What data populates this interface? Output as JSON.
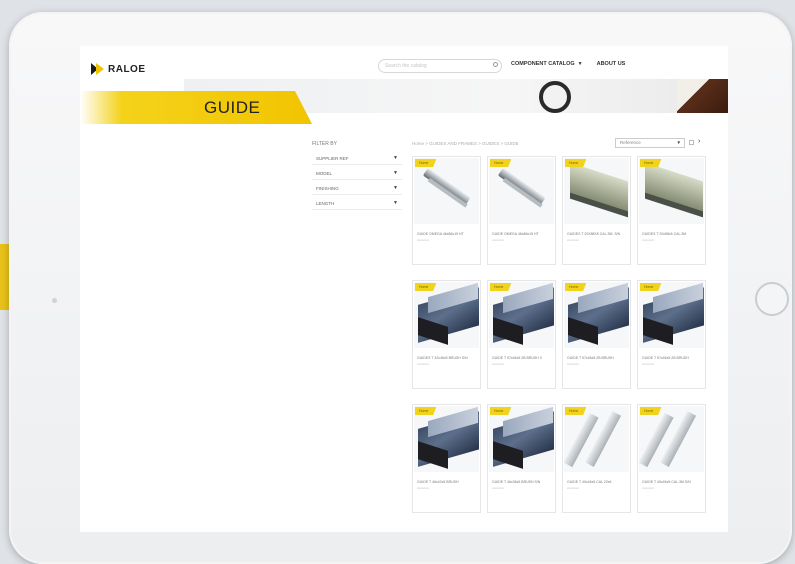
{
  "brand": {
    "name": "RALOE"
  },
  "header": {
    "search_placeholder": "Search the catalog",
    "nav": [
      {
        "label": "COMPONENT CATALOG"
      },
      {
        "label": "ABOUT US"
      }
    ]
  },
  "banner": {
    "title": "GUIDE"
  },
  "filters": {
    "title": "FILTER BY",
    "items": [
      {
        "label": "SUPPLIER REF"
      },
      {
        "label": "MODEL"
      },
      {
        "label": "FINISHING"
      },
      {
        "label": "LENGTH"
      }
    ]
  },
  "breadcrumb": "Home > GUIDES AND FRAMES > GUIDES > GUIDE",
  "sort": {
    "selected": "Reference"
  },
  "products": [
    {
      "name": "GUIDE OMEGA 46x86x15 HT",
      "badge": "Home",
      "sub": "xxxxxxxx",
      "shape": "rail"
    },
    {
      "name": "GUIDE OMEGA 46x86x15 HT",
      "badge": "Home",
      "sub": "xxxxxxxx",
      "shape": "rail"
    },
    {
      "name": "GUIDES T 20X88X5 CAL.3M. S/N",
      "badge": "Home",
      "sub": "xxxxxxxx",
      "shape": "plate"
    },
    {
      "name": "GUIDES T 20x88x5 CAL.3M",
      "badge": "Home",
      "sub": "xxxxxxxx",
      "shape": "plate"
    },
    {
      "name": "GUIDES T 32x46x5 BRUSH S/N",
      "badge": "Home",
      "sub": "xxxxxxxx",
      "shape": "box"
    },
    {
      "name": "GUIDE T 57x46x5 2B BRUSH 3",
      "badge": "Home",
      "sub": "xxxxxxxx",
      "shape": "box"
    },
    {
      "name": "GUIDE T 57x46x5 2B BRUSH",
      "badge": "Home",
      "sub": "xxxxxxxx",
      "shape": "box"
    },
    {
      "name": "GUIDE T 57x46x5 2B BRUSH",
      "badge": "Home",
      "sub": "xxxxxxxx",
      "shape": "box"
    },
    {
      "name": "GUIDE T 46x42x5 BRUSH",
      "badge": "Home",
      "sub": "xxxxxxxx",
      "shape": "box"
    },
    {
      "name": "GUIDE T 46x38x5 BRUSH S/N",
      "badge": "Home",
      "sub": "xxxxxxxx",
      "shape": "box"
    },
    {
      "name": "GUIDE T 40x46x5 CAL 22x6",
      "badge": "Home",
      "sub": "xxxxxxxx",
      "shape": "tguide"
    },
    {
      "name": "GUIDE T 40x46x5 CAL.3M S/N",
      "badge": "Home",
      "sub": "xxxxxxxx",
      "shape": "tguide"
    }
  ]
}
